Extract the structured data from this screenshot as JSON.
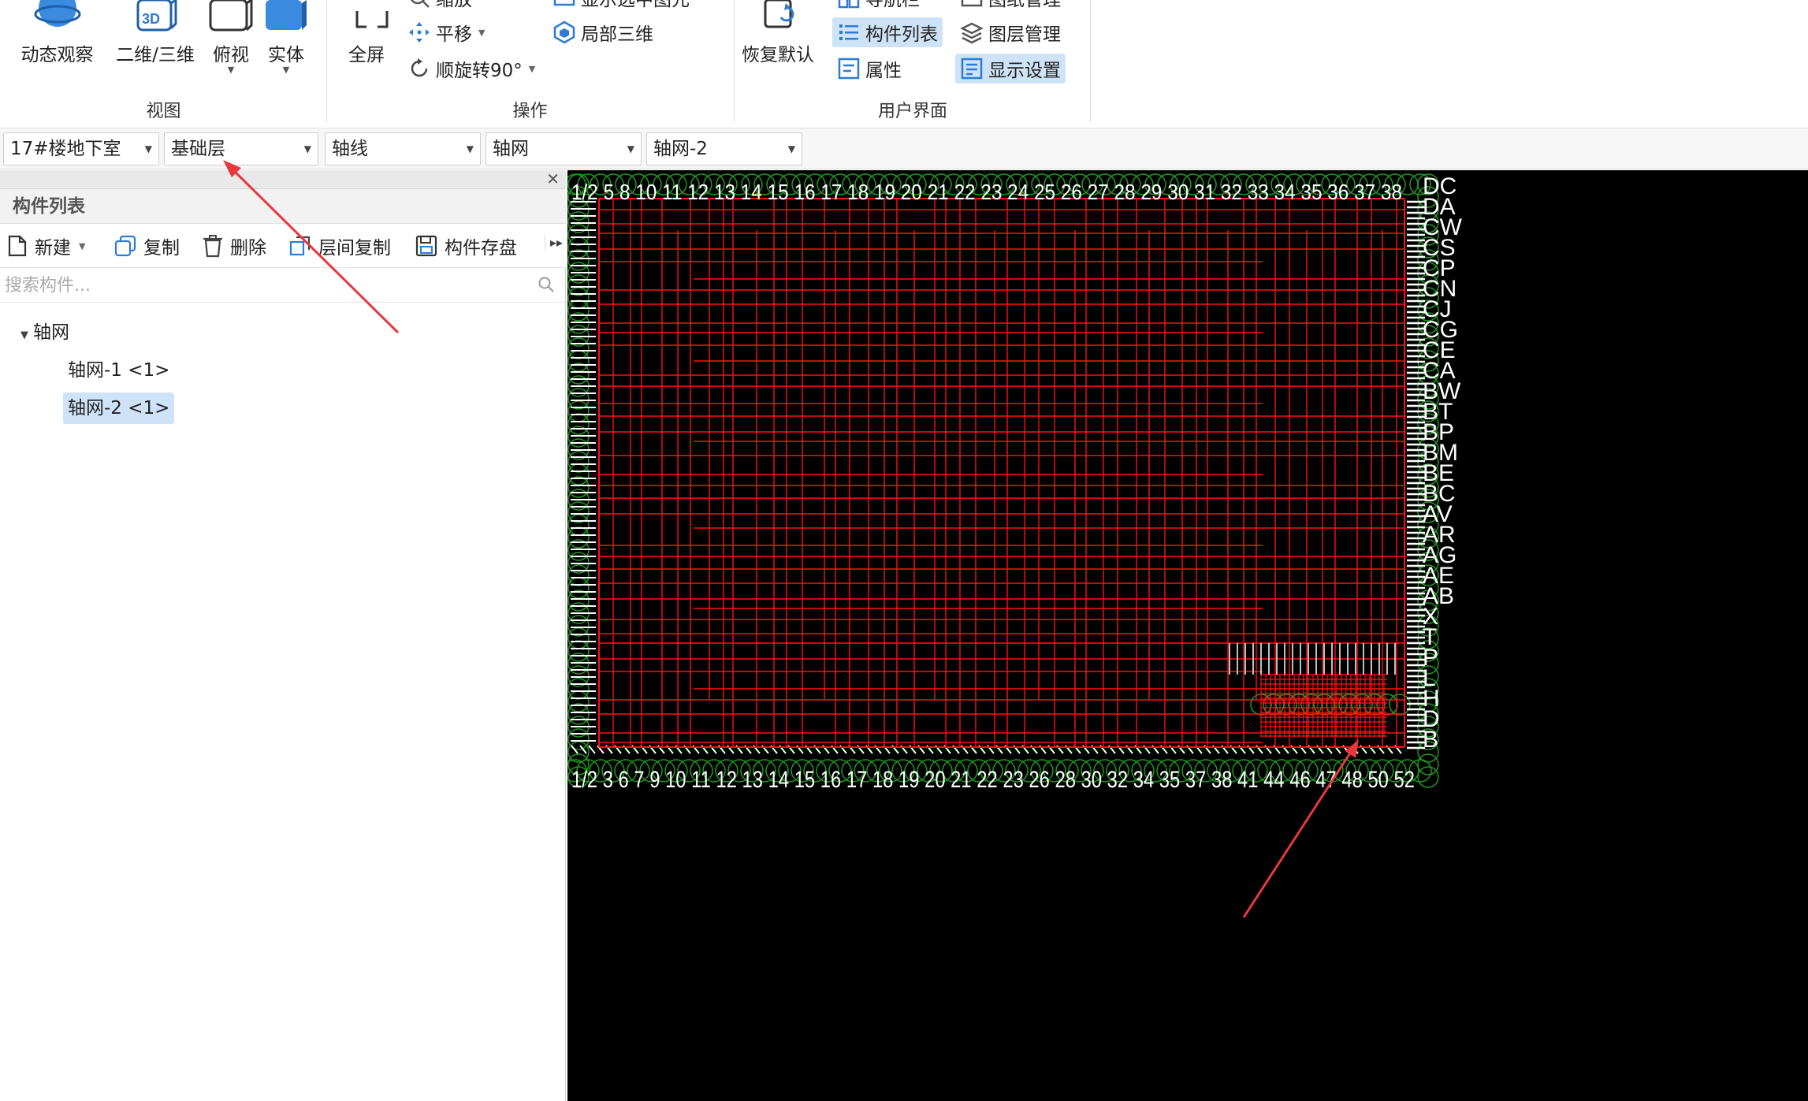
{
  "ribbon": {
    "view_group": {
      "label": "视图",
      "buttons": [
        {
          "label": "动态观察",
          "icon": "orbit-icon"
        },
        {
          "label": "二维/三维",
          "icon": "3d-toggle-icon",
          "badge": "3D"
        },
        {
          "label": "俯视",
          "icon": "top-view-icon"
        },
        {
          "label": "实体",
          "icon": "solid-icon"
        }
      ]
    },
    "operate_group": {
      "label": "操作",
      "fullscreen": "全屏",
      "zoom": "缩放",
      "pan": "平移",
      "rotate": "顺旋转90°",
      "show_selected": "显示选中图元",
      "local_3d": "局部三维"
    },
    "ui_group": {
      "label": "用户界面",
      "restore_default": "恢复默认",
      "navigator": "导航栏",
      "component_list": "构件列表",
      "properties": "属性",
      "drawing_mgmt": "图纸管理",
      "layer_mgmt": "图层管理",
      "display_settings": "显示设置"
    }
  },
  "selectors": {
    "building": "17#楼地下室",
    "floor": "基础层",
    "category": "轴线",
    "type": "轴网",
    "item": "轴网-2"
  },
  "panel": {
    "title": "构件列表",
    "toolbar": {
      "new": "新建",
      "copy": "复制",
      "delete": "删除",
      "floor_copy": "层间复制",
      "save": "构件存盘"
    },
    "search_placeholder": "搜索构件...",
    "tree": {
      "root": "轴网",
      "items": [
        {
          "label": "轴网-1 <1>"
        },
        {
          "label": "轴网-2 <1>"
        }
      ]
    }
  },
  "colors": {
    "accent": "#2e7bd6",
    "selected": "#cfe3f8",
    "canvas_bg": "#000000",
    "grid_line": "#ff1010",
    "axis_text": "#ffffff",
    "bubble": "#1f9a1f",
    "annotation_arrow": "#e8383b"
  },
  "canvas": {
    "top_axis_labels": "1/2 5 8 10 11 12 13 14 15 16 17 18 19 20 21 22 23 24 25 26 27 28 29 30 31 32 33 34 35 36 37 38",
    "bottom_axis_labels": "1/2 3 6 7 9 10 11 12 13 14 15 16 17 18 19 20 21 22 23 26 28 30 32 34 35 37 38 41 44 46 47 48 50 52",
    "right_axis_labels": [
      "DC",
      "DA",
      "CW",
      "CS",
      "CP",
      "CN",
      "CJ",
      "CG",
      "CE",
      "CA",
      "BW",
      "BT",
      "BP",
      "BM",
      "BE",
      "BC",
      "AV",
      "AR",
      "AG",
      "AE",
      "AB",
      "X",
      "T",
      "P",
      "L",
      "H",
      "D",
      "B"
    ]
  }
}
